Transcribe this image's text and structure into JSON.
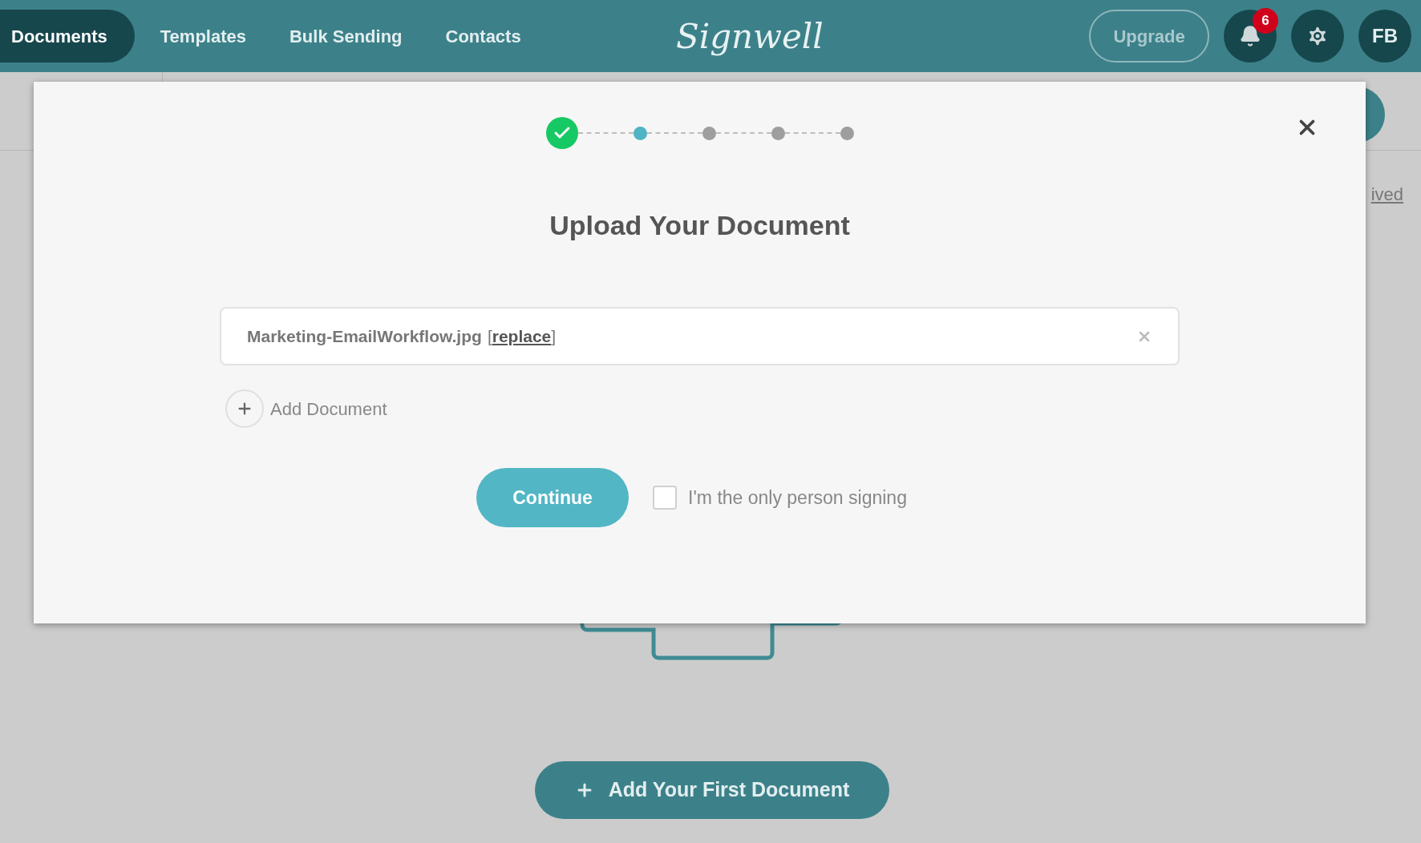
{
  "nav": {
    "items": [
      {
        "label": "Documents",
        "selected": true
      },
      {
        "label": "Templates",
        "selected": false
      },
      {
        "label": "Bulk Sending",
        "selected": false
      },
      {
        "label": "Contacts",
        "selected": false
      }
    ],
    "logo": "Signwell",
    "upgrade": "Upgrade",
    "notifications": "6",
    "avatar": "FB"
  },
  "background": {
    "link": "ived",
    "add_button": "Add Your First Document"
  },
  "modal": {
    "steps": [
      {
        "done": true,
        "selected": false
      },
      {
        "done": false,
        "selected": true
      },
      {
        "done": false,
        "selected": false
      },
      {
        "done": false,
        "selected": false
      },
      {
        "done": false,
        "selected": false
      }
    ],
    "title": "Upload Your Document",
    "file": {
      "name": "Marketing-EmailWorkflow.jpg",
      "bracket_open": "[",
      "replace": "replace",
      "bracket_close": "]"
    },
    "add_document": "Add Document",
    "continue": "Continue",
    "only_signer": {
      "label": "I'm the only person signing",
      "checked": false
    }
  }
}
